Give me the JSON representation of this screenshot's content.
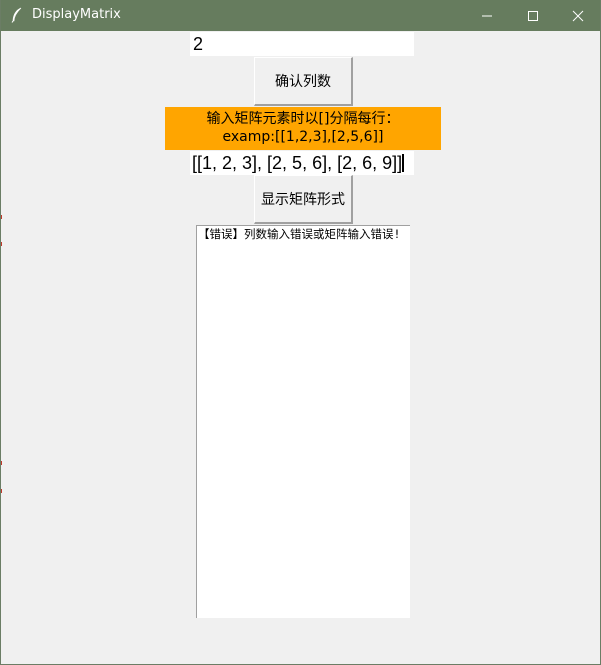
{
  "window": {
    "title": "DisplayMatrix",
    "icon": "feather-icon",
    "controls": [
      "minimize-icon",
      "maximize-icon",
      "close-icon"
    ]
  },
  "columns": {
    "value": "2",
    "confirm_label": "确认列数"
  },
  "hint": {
    "line1": "输入矩阵元素时以[]分隔每行：",
    "line2": "examp:[[1,2,3],[2,5,6]]",
    "background": "#ffa500"
  },
  "matrix": {
    "value": "[[1, 2, 3], [2, 5, 6], [2, 6, 9]]",
    "show_label": "显示矩阵形式"
  },
  "output": {
    "text": "【错误】列数输入错误或矩阵输入错误!"
  },
  "colors": {
    "titlebar": "#667c5e",
    "background": "#f0f0f0"
  }
}
